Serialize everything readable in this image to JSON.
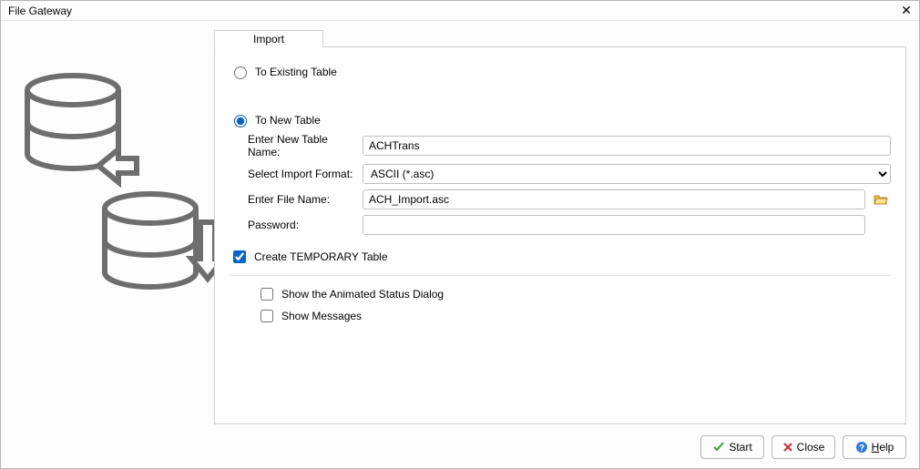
{
  "window": {
    "title": "File Gateway"
  },
  "tab": {
    "label": "Import"
  },
  "radios": {
    "existing_label": "To Existing Table",
    "new_label": "To New Table",
    "selected": "new"
  },
  "form": {
    "table_name_label": "Enter New Table Name:",
    "table_name_value": "ACHTrans",
    "format_label": "Select Import Format:",
    "format_value": "ASCII (*.asc)",
    "file_name_label": "Enter File Name:",
    "file_name_value": "ACH_Import.asc",
    "password_label": "Password:",
    "password_value": ""
  },
  "temp_table": {
    "label": "Create TEMPORARY Table",
    "checked": true
  },
  "options": {
    "animated_label": "Show the Animated Status Dialog",
    "animated_checked": false,
    "messages_label": "Show Messages",
    "messages_checked": false
  },
  "buttons": {
    "start": "Start",
    "close": "Close",
    "help_prefix": "H",
    "help_rest": "elp"
  }
}
